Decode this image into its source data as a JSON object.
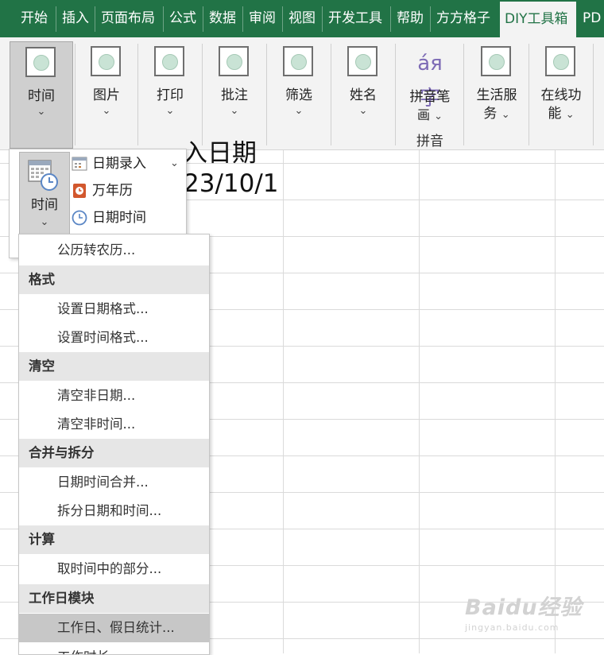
{
  "tabs": [
    "开始",
    "插入",
    "页面布局",
    "公式",
    "数据",
    "审阅",
    "视图",
    "开发工具",
    "帮助",
    "方方格子",
    "DIY工具箱",
    "PD"
  ],
  "active_tab": "DIY工具箱",
  "ribbon": {
    "time": "时间",
    "picture": "图片",
    "print": "打印",
    "comment": "批注",
    "filter": "筛选",
    "name": "姓名",
    "pinyin_line1": "拼音笔",
    "pinyin_line2": "画",
    "pinyin_group": "拼音",
    "life_line1": "生活服",
    "life_line2": "务",
    "online_line1": "在线功",
    "online_line2": "能",
    "pinyin_icon_text": "áя字"
  },
  "cells": {
    "partial_header": "入日期",
    "partial_date": "23/10/1"
  },
  "dropdown": {
    "time_button": "时间",
    "date_entry": "日期录入",
    "perpetual_calendar": "万年历",
    "date_time": "日期时间"
  },
  "menu": {
    "solar_to_lunar": "公历转农历...",
    "h_format": "格式",
    "set_date_format": "设置日期格式...",
    "set_time_format": "设置时间格式...",
    "h_clear": "清空",
    "clear_non_date": "清空非日期...",
    "clear_non_time": "清空非时间...",
    "h_merge_split": "合并与拆分",
    "merge_datetime": "日期时间合并...",
    "split_datetime": "拆分日期和时间...",
    "h_calc": "计算",
    "extract_time_part": "取时间中的部分...",
    "h_workday": "工作日模块",
    "workday_stats": "工作日、假日统计...",
    "work_duration": "工作时长"
  },
  "watermark": {
    "line1": "Baidu经验",
    "line2": "jingyan.baidu.com"
  },
  "colors": {
    "excel_green": "#217346",
    "ribbon_bg": "#f3f3f3"
  }
}
